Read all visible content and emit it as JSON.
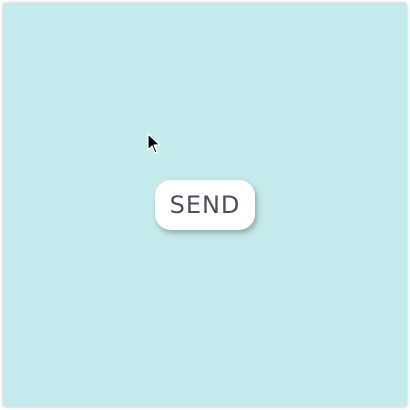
{
  "button": {
    "label": "SEND"
  },
  "colors": {
    "background": "#c5eaeb",
    "button_background": "#ffffff",
    "button_text": "#4a4f5c"
  },
  "icons": {
    "cursor": "mouse-pointer-icon"
  }
}
